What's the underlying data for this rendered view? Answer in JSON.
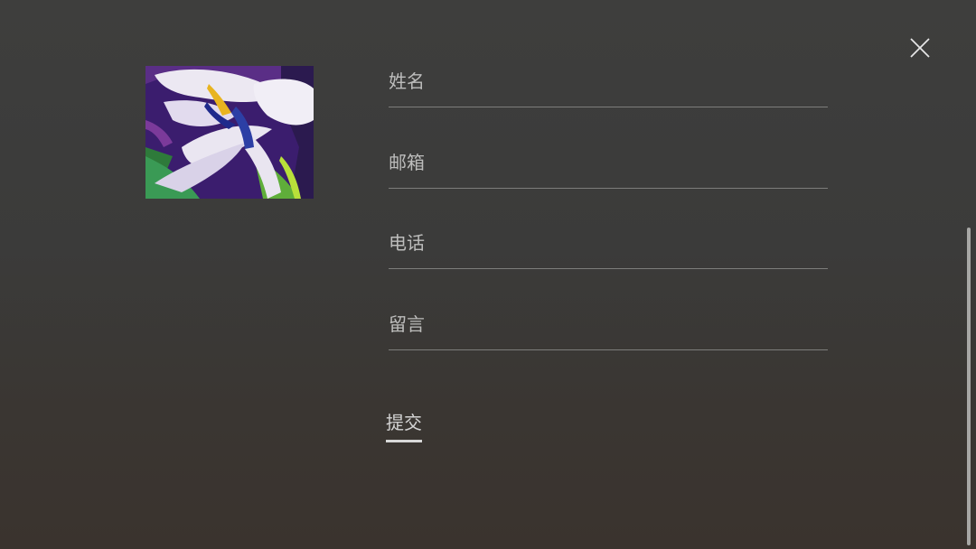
{
  "form": {
    "name_placeholder": "姓名",
    "email_placeholder": "邮箱",
    "phone_placeholder": "电话",
    "message_placeholder": "留言",
    "submit_label": "提交"
  },
  "colors": {
    "background": "#3d3d3c",
    "text": "#c9c9c9",
    "underline": "#7d7d7b",
    "scrollbar": "#a7a7a5"
  },
  "icons": {
    "close": "close-icon"
  }
}
